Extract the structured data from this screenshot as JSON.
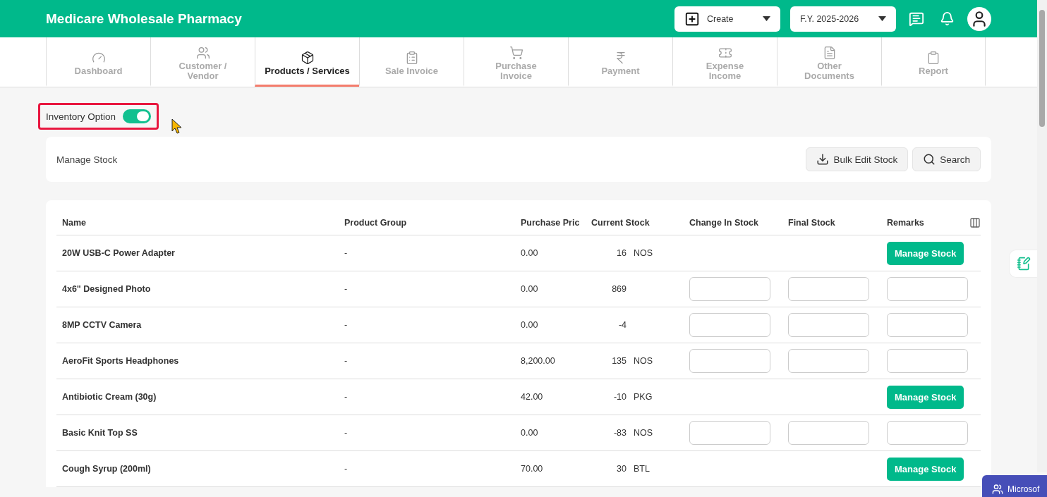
{
  "header": {
    "title": "Medicare Wholesale Pharmacy",
    "create_button": "Create",
    "fiscal_year": "F.Y. 2025-2026"
  },
  "nav_tabs": [
    {
      "label": "Dashboard",
      "selected": false
    },
    {
      "label": "Customer / Vendor",
      "selected": false
    },
    {
      "label": "Products / Services",
      "selected": true
    },
    {
      "label": "Sale Invoice",
      "selected": false
    },
    {
      "label": "Purchase Invoice",
      "selected": false
    },
    {
      "label": "Payment",
      "selected": false
    },
    {
      "label": "Expense Income",
      "selected": false
    },
    {
      "label": "Other Documents",
      "selected": false
    },
    {
      "label": "Report",
      "selected": false
    }
  ],
  "inventory_option": {
    "label": "Inventory Option",
    "on": true
  },
  "manage_stock_bar": {
    "title": "Manage Stock",
    "buttons": [
      "Bulk Edit Stock",
      "Search"
    ]
  },
  "table": {
    "columns": [
      "Name",
      "Product Group",
      "Purchase Pric",
      "Current Stock",
      "Change In Stock",
      "Final Stock",
      "Remarks"
    ],
    "rows": [
      {
        "name": "20W USB-C Power Adapter",
        "group": "-",
        "price": "0.00",
        "stock": "16",
        "unit": "NOS",
        "kind": "action",
        "action": "Manage Stock"
      },
      {
        "name": "4x6\" Designed Photo",
        "group": "-",
        "price": "0.00",
        "stock": "869",
        "kind": "editable"
      },
      {
        "name": "8MP CCTV Camera",
        "group": "-",
        "price": "0.00",
        "stock": "-4",
        "kind": "editable"
      },
      {
        "name": "AeroFit Sports Headphones",
        "group": "-",
        "price": "8,200.00",
        "stock": "135",
        "unit": "NOS",
        "kind": "editable"
      },
      {
        "name": "Antibiotic Cream (30g)",
        "group": "-",
        "price": "42.00",
        "stock": "-10",
        "unit": "PKG",
        "kind": "action",
        "action": "Manage Stock"
      },
      {
        "name": "Basic Knit Top SS",
        "group": "-",
        "price": "0.00",
        "stock": "-83",
        "unit": "NOS",
        "kind": "editable"
      },
      {
        "name": "Cough Syrup (200ml)",
        "group": "-",
        "price": "70.00",
        "stock": "30",
        "unit": "BTL",
        "kind": "action",
        "action": "Manage Stock"
      }
    ]
  },
  "teams_popup": {
    "label": "Microsof"
  }
}
